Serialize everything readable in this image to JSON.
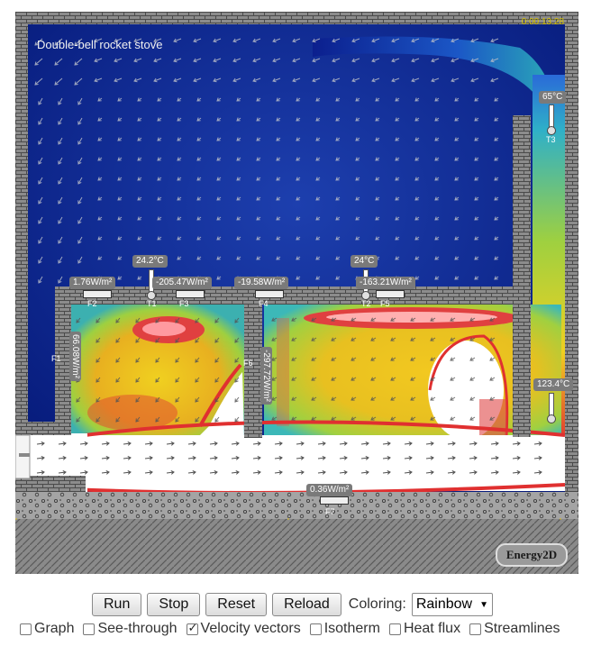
{
  "simulation": {
    "title": "Double-bell rocket stove",
    "clock": "0:00:13:28",
    "logo": "Energy2D",
    "temperature_labels": {
      "t1": "24.2°C",
      "t2": "24°C",
      "t3": "65°C",
      "t4": "123.4°C"
    },
    "sensor_ids": {
      "t1": "T1",
      "t2": "T2",
      "t3": "T3",
      "f1": "F1",
      "f2": "F2",
      "f3": "F3",
      "f4": "F4",
      "f5": "F5",
      "f6": "F6",
      "f7": "F7"
    },
    "flux_labels": {
      "f1": "66.08W/m²",
      "f2": "1.76W/m²",
      "f3": "-205.47W/m²",
      "f4": "-19.58W/m²",
      "f5": "-163.21W/m²",
      "f6": "-297.72W/m²",
      "f7": "0.36W/m²"
    },
    "colors": {
      "cold": "#0a1c8c",
      "mid": "#2a5de0",
      "warm": "#e8d020",
      "hot": "#e03030",
      "hottest": "#ffffff",
      "wall": "#8a8a8a"
    }
  },
  "controls": {
    "buttons": {
      "run": "Run",
      "stop": "Stop",
      "reset": "Reset",
      "reload": "Reload"
    },
    "coloring_label": "Coloring:",
    "coloring_value": "Rainbow",
    "checkboxes": {
      "graph": "Graph",
      "see_through": "See-through",
      "velocity_vectors": "Velocity vectors",
      "isotherm": "Isotherm",
      "heat_flux": "Heat flux",
      "streamlines": "Streamlines"
    },
    "checked": {
      "graph": false,
      "see_through": false,
      "velocity_vectors": true,
      "isotherm": false,
      "heat_flux": false,
      "streamlines": false
    }
  }
}
